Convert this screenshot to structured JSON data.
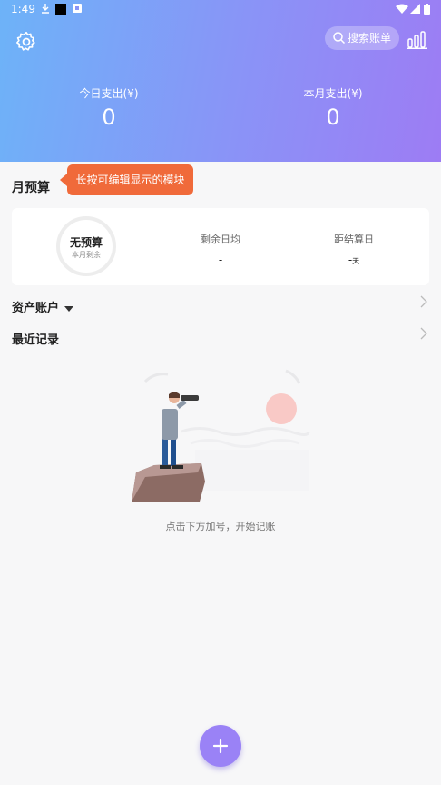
{
  "status_bar": {
    "time": "1:49"
  },
  "header": {
    "search_label": "搜索账单",
    "today_label": "今日支出(¥)",
    "today_value": "0",
    "month_label": "本月支出(¥)",
    "month_value": "0"
  },
  "tooltip": "长按可编辑显示的模块",
  "budget": {
    "title": "月预算",
    "ring_main": "无预算",
    "ring_sub": "本月剩余",
    "daily_label": "剩余日均",
    "daily_value": "-",
    "settle_label": "距结算日",
    "settle_value": "-",
    "settle_unit": "天"
  },
  "assets": {
    "title": "资产账户"
  },
  "recent": {
    "title": "最近记录"
  },
  "empty": {
    "hint": "点击下方加号，开始记账"
  },
  "colors": {
    "accent": "#9a82f6",
    "tooltip": "#f06a3a"
  }
}
